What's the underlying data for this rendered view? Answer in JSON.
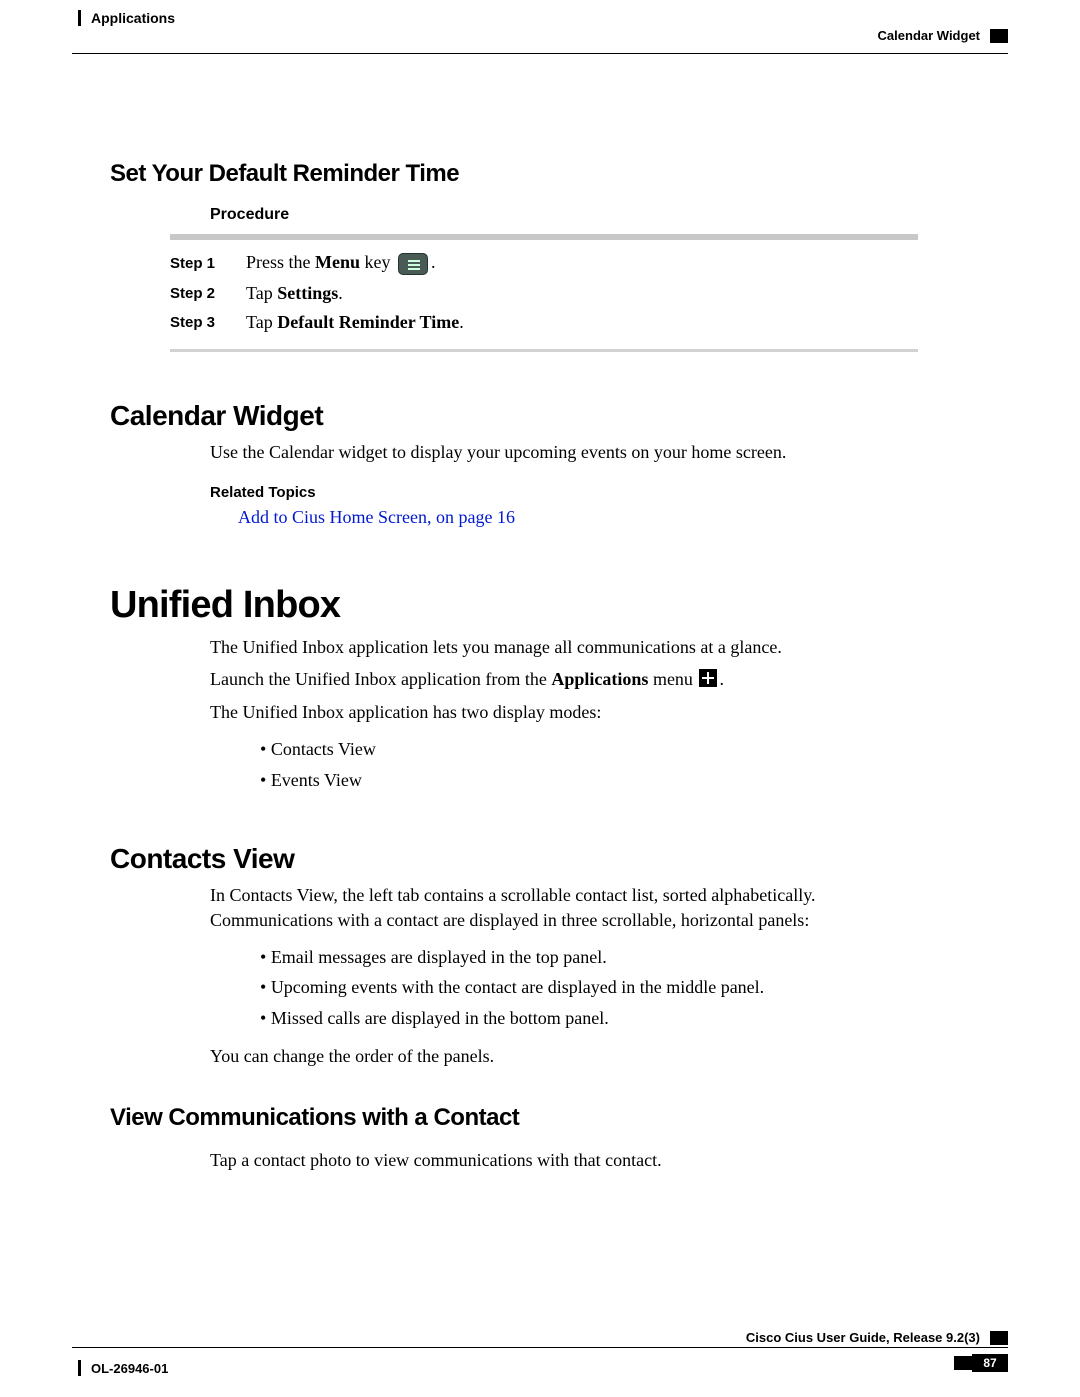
{
  "header": {
    "left": "Applications",
    "right": "Calendar Widget"
  },
  "reminder": {
    "title": "Set Your Default Reminder Time",
    "procedure_label": "Procedure",
    "steps": {
      "s1_label": "Step 1",
      "s1_prefix": "Press the ",
      "s1_bold": "Menu",
      "s1_suffix": " key ",
      "s1_tail": ".",
      "s2_label": "Step 2",
      "s2_prefix": "Tap ",
      "s2_bold": "Settings",
      "s2_tail": ".",
      "s3_label": "Step 3",
      "s3_prefix": "Tap ",
      "s3_bold": "Default Reminder Time",
      "s3_tail": "."
    }
  },
  "widget": {
    "title": "Calendar Widget",
    "para": "Use the Calendar widget to display your upcoming events on your home screen.",
    "related_label": "Related Topics",
    "link": "Add to Cius Home Screen,  on page 16"
  },
  "unified": {
    "title": "Unified Inbox",
    "p1": "The Unified Inbox application lets you manage all communications at a glance.",
    "p2_prefix": "Launch the Unified Inbox application from the ",
    "p2_bold": "Applications",
    "p2_suffix": " menu ",
    "p2_tail": ".",
    "p3": "The Unified Inbox application has two display modes:",
    "b1": "Contacts View",
    "b2": "Events View"
  },
  "contacts": {
    "title": "Contacts View",
    "p1": "In Contacts View, the left tab contains a scrollable contact list, sorted alphabetically. Communications with a contact are displayed in three scrollable, horizontal panels:",
    "b1": "Email messages are displayed in the top panel.",
    "b2": "Upcoming events with the contact are displayed in the middle panel.",
    "b3": "Missed calls are displayed in the bottom panel.",
    "p2": "You can change the order of the panels."
  },
  "viewcomm": {
    "title": "View Communications with a Contact",
    "p1": "Tap a contact photo to view communications with that contact."
  },
  "footer": {
    "left": "OL-26946-01",
    "right": "Cisco Cius User Guide, Release 9.2(3)",
    "page": "87"
  }
}
